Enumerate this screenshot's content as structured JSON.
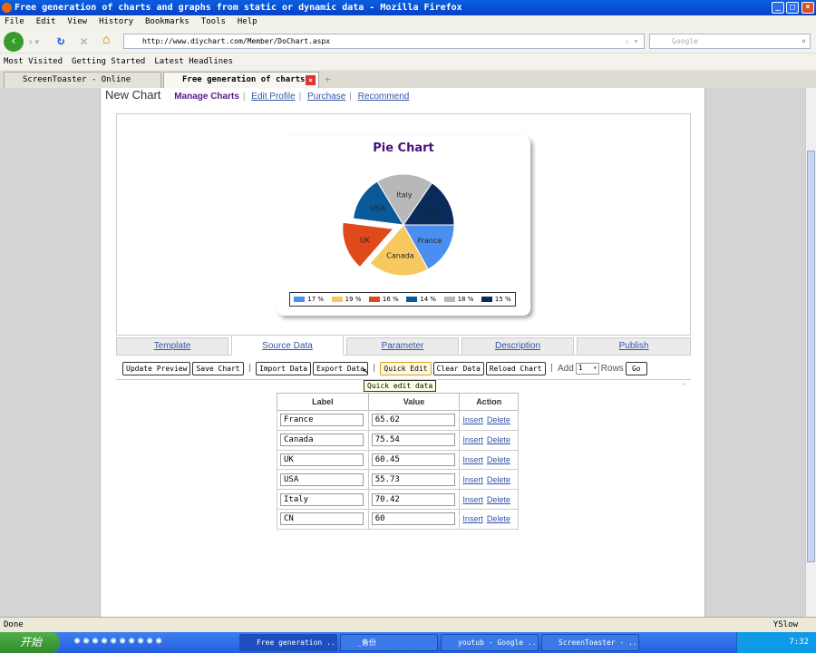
{
  "window": {
    "title": "Free generation of charts and graphs from static or dynamic data - Mozilla Firefox"
  },
  "menu": [
    "File",
    "Edit",
    "View",
    "History",
    "Bookmarks",
    "Tools",
    "Help"
  ],
  "nav": {
    "url": "http://www.diychart.com/Member/DoChart.aspx",
    "search_placeholder": "Google"
  },
  "bookmarks": [
    "Most Visited",
    "Getting Started",
    "Latest Headlines"
  ],
  "browser_tabs": [
    {
      "label": "ScreenToaster - Online screen r···"
    },
    {
      "label": "Free generation of charts ···",
      "active": true
    }
  ],
  "subnav": {
    "heading": "New Chart",
    "links": [
      "Manage Charts",
      "Edit Profile",
      "Purchase",
      "Recommend"
    ]
  },
  "chart_data": {
    "type": "pie",
    "title": "Pie Chart",
    "categories": [
      "France",
      "Canada",
      "UK",
      "USA",
      "Italy",
      "CN"
    ],
    "values": [
      65.62,
      75.54,
      60.45,
      55.73,
      70.42,
      60
    ],
    "percent_labels": [
      "17 %",
      "19 %",
      "16 %",
      "14 %",
      "18 %",
      "15 %"
    ],
    "colors": [
      "#4a8ff0",
      "#f8c860",
      "#e04a1a",
      "#0a5a9a",
      "#b8b8b8",
      "#0a2a5a"
    ],
    "exploded": "UK",
    "legend_position": "bottom"
  },
  "panel_tabs": [
    "Template",
    "Source Data",
    "Parameter",
    "Description",
    "Publish"
  ],
  "active_panel_tab": "Source Data",
  "toolbar": {
    "update_preview": "Update Preview",
    "save_chart": "Save Chart",
    "import_data": "Import Data",
    "export_data": "Export Data",
    "quick_edit": "Quick Edit",
    "clear_data": "Clear Data",
    "reload_chart": "Reload Chart",
    "add_label": "Add",
    "rows_value": "1",
    "rows_label": "Rows",
    "go": "Go"
  },
  "tooltip": "Quick edit data",
  "table": {
    "headers": [
      "Label",
      "Value",
      "Action"
    ],
    "insert": "Insert",
    "delete": "Delete",
    "rows": [
      {
        "label": "France",
        "value": "65.62"
      },
      {
        "label": "Canada",
        "value": "75.54"
      },
      {
        "label": "UK",
        "value": "60.45"
      },
      {
        "label": "USA",
        "value": "55.73"
      },
      {
        "label": "Italy",
        "value": "70.42"
      },
      {
        "label": "CN",
        "value": "60"
      }
    ]
  },
  "status": {
    "text": "Done",
    "yslow": "YSlow"
  },
  "taskbar": {
    "start": "开始",
    "tasks": [
      "Free generation ...",
      "_备份",
      "youtub - Google ...",
      "ScreenToaster - ..."
    ],
    "clock": "7:32"
  }
}
